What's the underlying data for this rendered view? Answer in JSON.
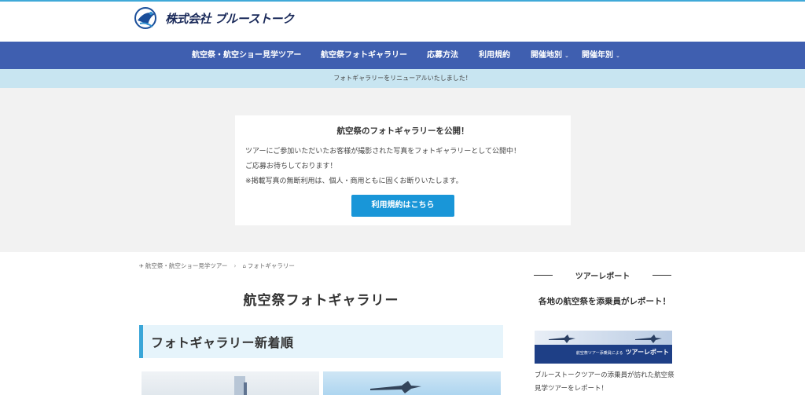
{
  "header": {
    "logo_text": "株式会社 ブルーストーク"
  },
  "nav": {
    "items": [
      {
        "label": "航空祭・航空ショー見学ツアー",
        "has_dropdown": false
      },
      {
        "label": "航空祭フォトギャラリー",
        "has_dropdown": false
      },
      {
        "label": "応募方法",
        "has_dropdown": false
      },
      {
        "label": "利用規約",
        "has_dropdown": false
      },
      {
        "label": "開催地別",
        "has_dropdown": true
      },
      {
        "label": "開催年別",
        "has_dropdown": true
      }
    ]
  },
  "notice": {
    "text": "フォトギャラリーをリニューアルいたしました！"
  },
  "hero_card": {
    "title": "航空祭のフォトギャラリーを公開！",
    "lines": [
      "ツアーにご参加いただいたお客様が撮影された写真をフォトギャラリーとして公開中！",
      "ご応募お待ちしております！",
      "※掲載写真の無断利用は、個人・商用ともに固くお断りいたします。"
    ],
    "button_label": "利用規約はこちら"
  },
  "breadcrumb": {
    "items": [
      "航空祭・航空ショー見学ツアー",
      "フォトギャラリー"
    ]
  },
  "main": {
    "page_title": "航空祭フォトギャラリー",
    "section_heading": "フォトギャラリー新着順"
  },
  "sidebar": {
    "heading": "ツアーレポート",
    "title": "各地の航空祭を添乗員がレポート！",
    "banner_text": "ツアーレポート",
    "banner_subtext": "航空祭ツアー添乗員による",
    "description": "ブルーストークツアーの添乗員が訪れた航空祭見学ツアーをレポート！"
  },
  "colors": {
    "accent": "#3fa9d8",
    "nav_bg": "#3f5fb0",
    "notice_bg": "#c8e5f1",
    "button_bg": "#1996d8",
    "section_heading_bg": "#e6f4fb"
  }
}
